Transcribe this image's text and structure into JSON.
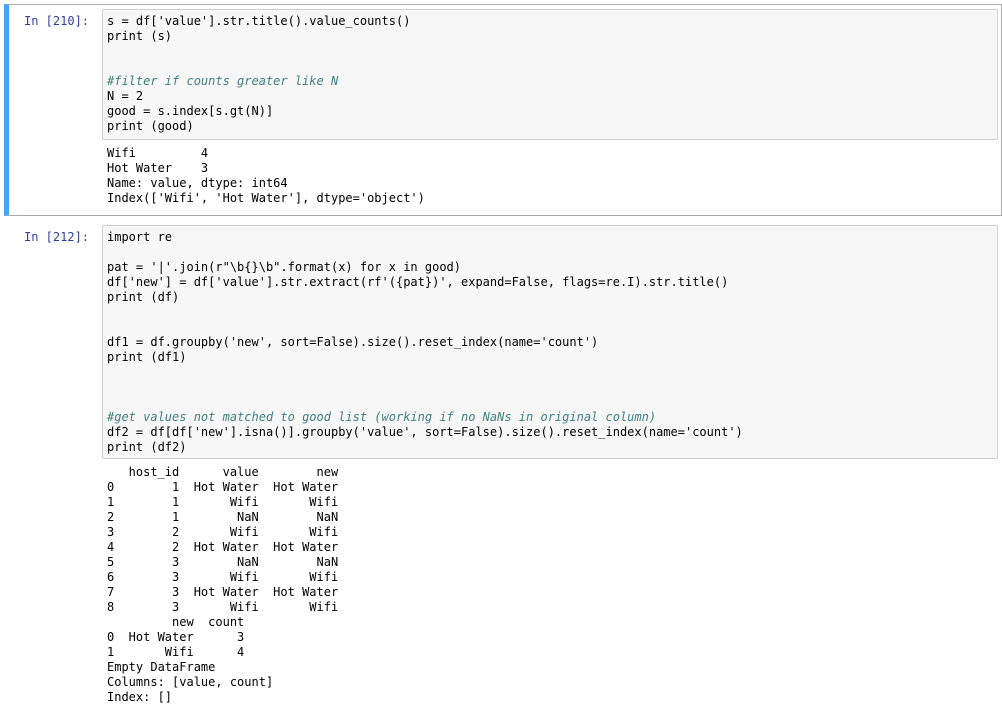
{
  "cells": [
    {
      "prompt": "In [210]:",
      "code": [
        "s = df['value'].str.title().value_counts()",
        "print (s)",
        "",
        "",
        "#filter if counts greater like N",
        "N = 2",
        "good = s.index[s.gt(N)]",
        "print (good)"
      ],
      "output": [
        "Wifi         4",
        "Hot Water    3",
        "Name: value, dtype: int64",
        "Index(['Wifi', 'Hot Water'], dtype='object')"
      ]
    },
    {
      "prompt": "In [212]:",
      "code": [
        "import re",
        "",
        "pat = '|'.join(r\"\\b{}\\b\".format(x) for x in good)",
        "df['new'] = df['value'].str.extract(rf'({pat})', expand=False, flags=re.I).str.title()",
        "print (df)",
        "",
        "",
        "df1 = df.groupby('new', sort=False).size().reset_index(name='count')",
        "print (df1)",
        "",
        "",
        "",
        "#get values not matched to good list (working if no NaNs in original column)",
        "df2 = df[df['new'].isna()].groupby('value', sort=False).size().reset_index(name='count')",
        "print (df2)"
      ],
      "output": [
        "   host_id      value        new",
        "0        1  Hot Water  Hot Water",
        "1        1       Wifi       Wifi",
        "2        1        NaN        NaN",
        "3        2       Wifi       Wifi",
        "4        2  Hot Water  Hot Water",
        "5        3        NaN        NaN",
        "6        3       Wifi       Wifi",
        "7        3  Hot Water  Hot Water",
        "8        3       Wifi       Wifi",
        "         new  count",
        "0  Hot Water      3",
        "1       Wifi      4",
        "Empty DataFrame",
        "Columns: [value, count]",
        "Index: []"
      ]
    }
  ]
}
